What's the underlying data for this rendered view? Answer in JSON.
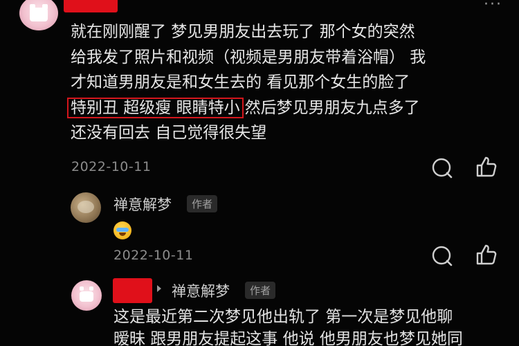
{
  "comment": {
    "text_lines": [
      "就在刚刚醒了 梦见男朋友出去玩了 那个女的突然",
      "给我发了照片和视频（视频是男朋友带着浴帽） 我",
      "才知道男朋友是和女生去的 看见那个女生的脸了"
    ],
    "highlight_text": "特别丑 超级瘦 眼睛特小",
    "highlight_rest": "然后梦见男朋友九点多了",
    "last_line": "还没有回去 自己觉得很失望",
    "date": "2022-10-11",
    "more_icon": "more-dots-icon"
  },
  "reply1": {
    "name": "禅意解梦",
    "badge": "作者",
    "emoji": "laughing-tears-emoji",
    "date": "2022-10-11"
  },
  "reply2": {
    "name": "禅意解梦",
    "badge": "作者",
    "text_lines": [
      "这是最近第二次梦见他出轨了 第一次是梦见他聊",
      "暧昧 跟男朋友提起这事 他说 他男朋友也梦见她同"
    ]
  },
  "icons": {
    "comment": "comment-bubble-icon",
    "like": "thumbs-up-icon",
    "reply_arrow": "reply-arrow-icon"
  },
  "colors": {
    "background": "#050505",
    "highlight_border": "#d4161c",
    "redaction": "#e0101a"
  }
}
